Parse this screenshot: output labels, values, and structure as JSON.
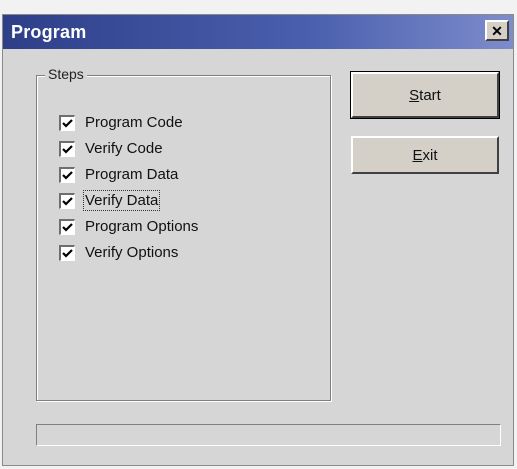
{
  "window": {
    "title": "Program",
    "close_icon": "close-icon"
  },
  "steps_group": {
    "legend": "Steps",
    "items": [
      {
        "label": "Program Code",
        "checked": true
      },
      {
        "label": "Verify Code",
        "checked": true
      },
      {
        "label": "Program Data",
        "checked": true
      },
      {
        "label": "Verify Data",
        "checked": true,
        "focused": true
      },
      {
        "label": "Program Options",
        "checked": true
      },
      {
        "label": "Verify Options",
        "checked": true
      }
    ]
  },
  "buttons": {
    "start": {
      "mnemonic": "S",
      "rest": "tart"
    },
    "exit": {
      "mnemonic": "E",
      "rest": "xit"
    }
  },
  "status": {
    "progress": 0
  },
  "colors": {
    "titlebar_start": "#2e3f88",
    "titlebar_end": "#7d8ccb",
    "face": "#d6d6d6"
  }
}
